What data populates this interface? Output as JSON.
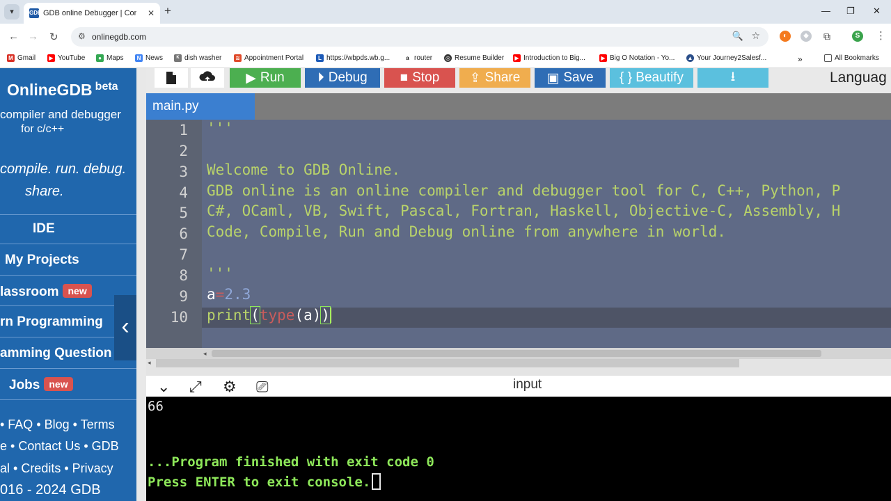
{
  "browser": {
    "tab_title": "GDB online Debugger | Compiler",
    "url": "onlinegdb.com",
    "profile_initial": "S",
    "bookmarks": [
      "Gmail",
      "YouTube",
      "Maps",
      "News",
      "dish washer",
      "Appointment Portal",
      "https://wbpds.wb.g...",
      "router",
      "Resume Builder",
      "Introduction to Big...",
      "Big O Notation - Yo...",
      "Your Journey2Salesf..."
    ],
    "all_bookmarks": "All Bookmarks"
  },
  "sidebar": {
    "brand": "OnlineGDB",
    "beta": "beta",
    "subtitle_line1": "compiler and debugger",
    "subtitle_line2": "for c/c++",
    "motto_line1": "compile. run. debug.",
    "motto_line2": "share.",
    "nav": [
      "IDE",
      "My Projects",
      "lassroom",
      "rn Programming",
      "amming Question",
      "Jobs"
    ],
    "new_badge": "new",
    "footer_line1": "• FAQ • Blog • Terms",
    "footer_line2": "e • Contact Us • GDB",
    "footer_line3": "al • Credits • Privacy",
    "footer_line4": "016 - 2024 GDB"
  },
  "actions": {
    "run": "Run",
    "debug": "Debug",
    "stop": "Stop",
    "share": "Share",
    "save": "Save",
    "beautify": "{ } Beautify",
    "language_label": "Languag"
  },
  "editor": {
    "filename": "main.py",
    "line_numbers": [
      "1",
      "2",
      "3",
      "4",
      "5",
      "6",
      "7",
      "8",
      "9",
      "10"
    ],
    "lines": {
      "l1": "'''",
      "l2": "",
      "l3": "Welcome to GDB Online.",
      "l4": "GDB online is an online compiler and debugger tool for C, C++, Python, P",
      "l5": "C#, OCaml, VB, Swift, Pascal, Fortran, Haskell, Objective-C, Assembly, H",
      "l6": "Code, Compile, Run and Debug online from anywhere in world.",
      "l7": "",
      "l8": "'''",
      "l9_var": "a",
      "l9_eq": "=",
      "l9_num": "2.3",
      "l10_fn": "print",
      "l10_p1": "(",
      "l10_type": "type",
      "l10_arg": "(a)",
      "l10_p2": ")"
    }
  },
  "console": {
    "input_label": "input",
    "output_line1": "66",
    "finished": "...Program finished with exit code 0",
    "press_enter": "Press ENTER to exit console."
  },
  "colors": {
    "run": "#4caf50",
    "debug": "#2f6db5",
    "stop": "#d9534f",
    "share": "#f0ad4e",
    "save": "#2f6db5",
    "beautify": "#5bc0de",
    "download": "#5bc0de",
    "sidebar": "#2067ad"
  }
}
